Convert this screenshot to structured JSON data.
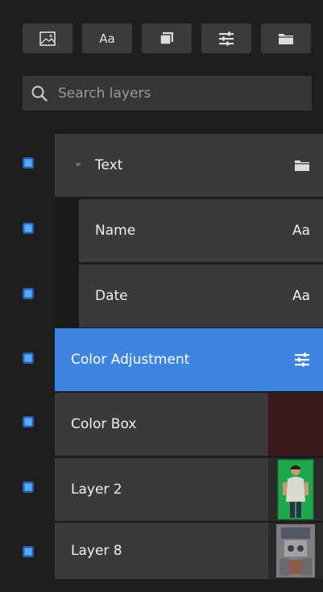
{
  "toolbar": {
    "buttons": [
      {
        "name": "image-layer",
        "icon": "image-icon"
      },
      {
        "name": "text-layer",
        "label": "Aa",
        "icon": "text-icon"
      },
      {
        "name": "shape-layer",
        "icon": "stack-icon"
      },
      {
        "name": "adjustment-layer",
        "icon": "sliders-icon"
      },
      {
        "name": "group-layer",
        "icon": "folder-icon"
      }
    ]
  },
  "search": {
    "placeholder": "Search layers",
    "value": ""
  },
  "layers": [
    {
      "label": "Text",
      "type": "group",
      "expanded": true,
      "visible": true,
      "icon": "folder-icon"
    },
    {
      "label": "Name",
      "type": "text",
      "visible": true,
      "type_label": "Aa"
    },
    {
      "label": "Date",
      "type": "text",
      "visible": true,
      "type_label": "Aa"
    },
    {
      "label": "Color Adjustment",
      "type": "adjustment",
      "visible": true,
      "selected": true,
      "icon": "sliders-icon"
    },
    {
      "label": "Color Box",
      "type": "color",
      "visible": true,
      "thumb_color": "#3a1a1c"
    },
    {
      "label": "Layer 2",
      "type": "image",
      "visible": true,
      "thumb": "person-green-screen"
    },
    {
      "label": "Layer 8",
      "type": "image",
      "visible": true,
      "thumb": "robot-photo"
    }
  ],
  "colors": {
    "accent": "#3d85e0",
    "checkbox": "#3d8ef0",
    "row_bg": "#3a3a3a",
    "panel_bg": "#1e1e1e"
  }
}
